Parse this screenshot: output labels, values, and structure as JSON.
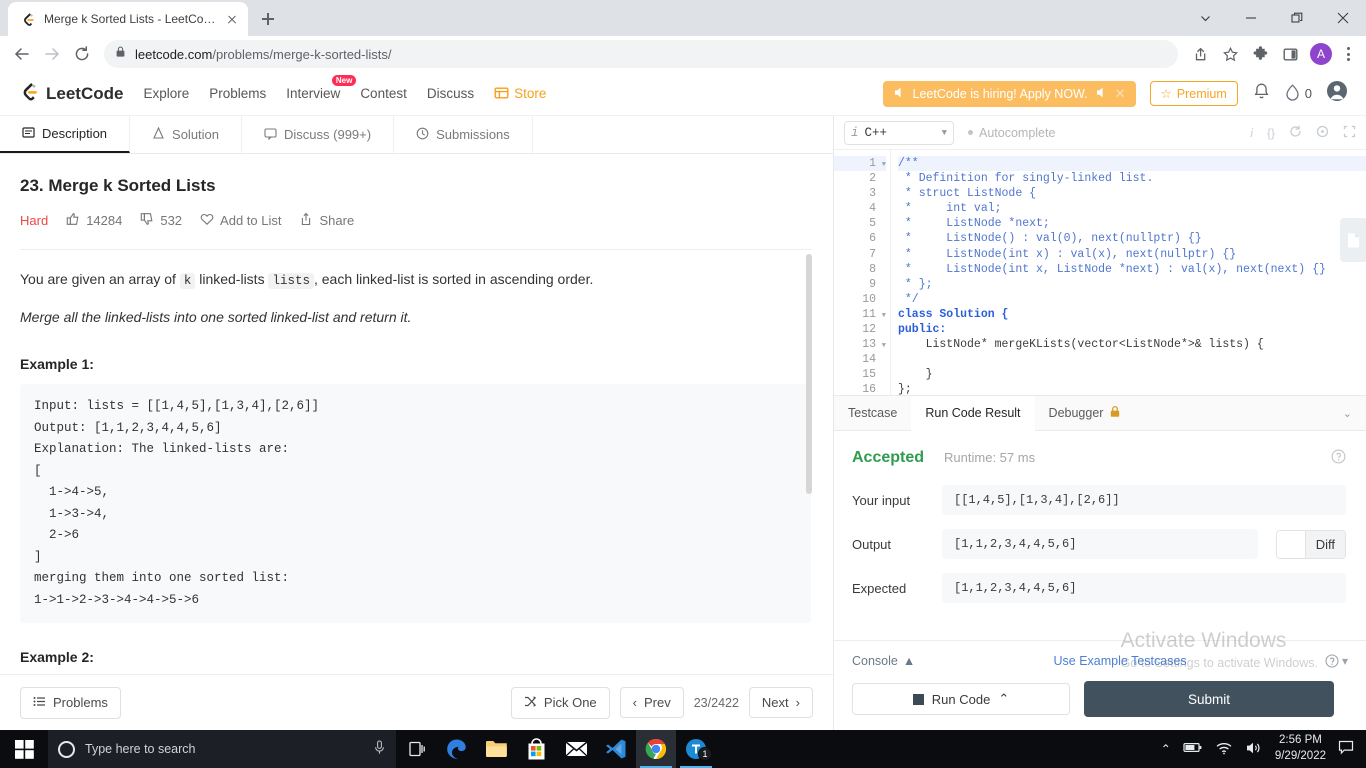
{
  "browser": {
    "tab_title": "Merge k Sorted Lists - LeetCode",
    "url_domain": "leetcode.com",
    "url_path": "/problems/merge-k-sorted-lists/",
    "new_tab_label": "+",
    "profile_initial": "A",
    "icons": {
      "back": "back-arrow-icon",
      "forward": "forward-arrow-icon",
      "reload": "reload-icon",
      "lock": "lock-icon",
      "share": "share-icon",
      "bookmark": "star-icon",
      "extensions": "puzzle-icon",
      "sidepanel": "side-panel-icon",
      "menu": "kebab-menu-icon"
    }
  },
  "nav": {
    "brand": "LeetCode",
    "links": [
      {
        "label": "Explore"
      },
      {
        "label": "Problems"
      },
      {
        "label": "Interview",
        "badge": "New"
      },
      {
        "label": "Contest"
      },
      {
        "label": "Discuss"
      },
      {
        "label": "Store"
      }
    ],
    "hiring_banner": "LeetCode is hiring! Apply NOW.",
    "premium_label": "Premium",
    "streak_count": "0"
  },
  "tabs": [
    {
      "label": "Description",
      "icon": "description-icon",
      "active": true
    },
    {
      "label": "Solution",
      "icon": "flask-icon",
      "active": false
    },
    {
      "label": "Discuss (999+)",
      "icon": "comment-icon",
      "active": false
    },
    {
      "label": "Submissions",
      "icon": "clock-icon",
      "active": false
    }
  ],
  "problem": {
    "title": "23. Merge k Sorted Lists",
    "difficulty": "Hard",
    "likes": "14284",
    "dislikes": "532",
    "add_to_list": "Add to List",
    "share": "Share",
    "statement_pre": "You are given an array of ",
    "statement_code1": "k",
    "statement_mid": " linked-lists ",
    "statement_code2": "lists",
    "statement_post": ", each linked-list is sorted in ascending order.",
    "statement_italic": "Merge all the linked-lists into one sorted linked-list and return it.",
    "example1_heading": "Example 1:",
    "example1_body": "Input: lists = [[1,4,5],[1,3,4],[2,6]]\nOutput: [1,1,2,3,4,4,5,6]\nExplanation: The linked-lists are:\n[\n  1->4->5,\n  1->3->4,\n  2->6\n]\nmerging them into one sorted list:\n1->1->2->3->4->4->5->6",
    "example2_heading": "Example 2:"
  },
  "left_footer": {
    "problems_label": "Problems",
    "pick_one_label": "Pick One",
    "prev_label": "Prev",
    "page_count": "23/2422",
    "next_label": "Next"
  },
  "editor": {
    "language": "C++",
    "autocomplete_label": "Autocomplete",
    "icons": [
      "info-icon",
      "format-braces-icon",
      "reset-icon",
      "settings-icon",
      "fullscreen-icon"
    ],
    "notes_tab_icon": "note-icon",
    "lines": [
      {
        "n": "1",
        "fold": true,
        "text": "/**",
        "cls": "cm-comment"
      },
      {
        "n": "2",
        "fold": false,
        "text": " * Definition for singly-linked list.",
        "cls": "cm-comment"
      },
      {
        "n": "3",
        "fold": false,
        "text": " * struct ListNode {",
        "cls": "cm-comment"
      },
      {
        "n": "4",
        "fold": false,
        "text": " *     int val;",
        "cls": "cm-comment"
      },
      {
        "n": "5",
        "fold": false,
        "text": " *     ListNode *next;",
        "cls": "cm-comment"
      },
      {
        "n": "6",
        "fold": false,
        "text": " *     ListNode() : val(0), next(nullptr) {}",
        "cls": "cm-comment"
      },
      {
        "n": "7",
        "fold": false,
        "text": " *     ListNode(int x) : val(x), next(nullptr) {}",
        "cls": "cm-comment"
      },
      {
        "n": "8",
        "fold": false,
        "text": " *     ListNode(int x, ListNode *next) : val(x), next(next) {}",
        "cls": "cm-comment"
      },
      {
        "n": "9",
        "fold": false,
        "text": " * };",
        "cls": "cm-comment"
      },
      {
        "n": "10",
        "fold": false,
        "text": " */",
        "cls": "cm-comment"
      },
      {
        "n": "11",
        "fold": true,
        "text": "class Solution {",
        "cls": "cm-kw"
      },
      {
        "n": "12",
        "fold": false,
        "text": "public:",
        "cls": "cm-kw"
      },
      {
        "n": "13",
        "fold": true,
        "text": "    ListNode* mergeKLists(vector<ListNode*>& lists) {",
        "cls": "cm-plain"
      },
      {
        "n": "14",
        "fold": false,
        "text": "",
        "cls": "cm-plain"
      },
      {
        "n": "15",
        "fold": false,
        "text": "    }",
        "cls": "cm-plain"
      },
      {
        "n": "16",
        "fold": false,
        "text": "};",
        "cls": "cm-plain"
      }
    ]
  },
  "result": {
    "tabs": [
      {
        "label": "Testcase",
        "active": false,
        "lock": false
      },
      {
        "label": "Run Code Result",
        "active": true,
        "lock": false
      },
      {
        "label": "Debugger",
        "active": false,
        "lock": true
      }
    ],
    "status": "Accepted",
    "status_color": "#2e9c4e",
    "runtime": "Runtime: 57 ms",
    "rows": [
      {
        "label": "Your input",
        "value": "[[1,4,5],[1,3,4],[2,6]]",
        "has_diff": false
      },
      {
        "label": "Output",
        "value": "[1,1,2,3,4,4,5,6]",
        "has_diff": true
      },
      {
        "label": "Expected",
        "value": "[1,1,2,3,4,4,5,6]",
        "has_diff": false
      }
    ],
    "diff_label": "Diff"
  },
  "right_footer": {
    "console_label": "Console",
    "use_example_label": "Use Example Testcases",
    "run_code_label": "Run Code",
    "submit_label": "Submit"
  },
  "watermark": {
    "line1": "Activate Windows",
    "line2": "Go to Settings to activate Windows."
  },
  "taskbar": {
    "search_placeholder": "Type here to search",
    "apps": [
      {
        "name": "task-view-icon"
      },
      {
        "name": "edge-icon"
      },
      {
        "name": "file-explorer-icon"
      },
      {
        "name": "microsoft-store-icon"
      },
      {
        "name": "mail-icon"
      },
      {
        "name": "vscode-icon"
      },
      {
        "name": "chrome-icon"
      },
      {
        "name": "teams-icon",
        "badge": "1"
      }
    ],
    "time": "2:56 PM",
    "date": "9/29/2022"
  }
}
